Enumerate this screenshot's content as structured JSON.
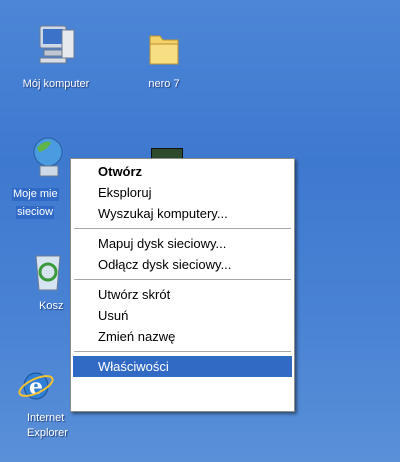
{
  "desktop": {
    "icons": [
      {
        "label": "Mój komputer"
      },
      {
        "label": "nero 7"
      },
      {
        "label": "Moje miejsca sieciowe",
        "label_line1": "Moje mie",
        "label_line2": "sieciow"
      },
      {
        "label": "Kosz",
        "label_short": "Kosz"
      },
      {
        "label": "Internet Explorer",
        "label_line1": "Internet",
        "label_line2": "Explorer"
      }
    ]
  },
  "context_menu": {
    "groups": [
      [
        {
          "label": "Otwórz",
          "default": true
        },
        {
          "label": "Eksploruj"
        },
        {
          "label": "Wyszukaj komputery..."
        }
      ],
      [
        {
          "label": "Mapuj dysk sieciowy..."
        },
        {
          "label": "Odłącz dysk sieciowy..."
        }
      ],
      [
        {
          "label": "Utwórz skrót"
        },
        {
          "label": "Usuń"
        },
        {
          "label": "Zmień nazwę"
        }
      ],
      [
        {
          "label": "Właściwości",
          "highlighted": true
        }
      ]
    ]
  },
  "colors": {
    "desktop": "#3e79d0",
    "highlight": "#316ac5"
  }
}
